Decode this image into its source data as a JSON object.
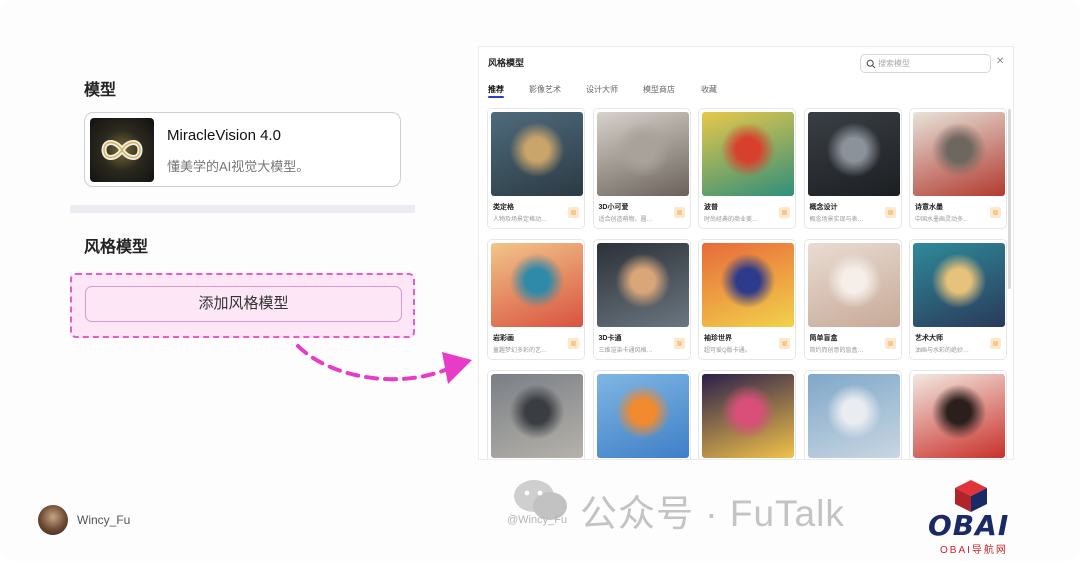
{
  "left": {
    "model_section_title": "模型",
    "model_name": "MiracleVision 4.0",
    "model_desc": "懂美学的AI视觉大模型。",
    "style_section_title": "风格模型",
    "add_style_button": "添加风格模型"
  },
  "dialog": {
    "title": "风格模型",
    "search_placeholder": "搜索模型",
    "close_symbol": "✕",
    "tabs": [
      "推荐",
      "影像艺术",
      "设计大师",
      "模型商店",
      "收藏"
    ],
    "active_tab": "推荐",
    "cards": [
      {
        "name": "类定格",
        "desc": "人物及场景定格动…",
        "colors": [
          "#4e6b7c",
          "#c9a46b",
          "#2c3a44"
        ]
      },
      {
        "name": "3D小可爱",
        "desc": "适合创造萌物。圆…",
        "colors": [
          "#d8d2cc",
          "#a9a29a",
          "#6a625a"
        ]
      },
      {
        "name": "波普",
        "desc": "时尚经典的商业美…",
        "colors": [
          "#e8c84a",
          "#d8402e",
          "#2f8f7a"
        ]
      },
      {
        "name": "概念设计",
        "desc": "概念场景实现与表…",
        "colors": [
          "#3a3f45",
          "#8b929a",
          "#1c1f22"
        ]
      },
      {
        "name": "诗意水墨",
        "desc": "中国水墨画灵动多…",
        "colors": [
          "#e7e3da",
          "#6d6760",
          "#b23a2f"
        ]
      },
      {
        "name": "岩彩画",
        "desc": "童趣梦幻多彩的艺…",
        "colors": [
          "#f2c58a",
          "#2e8aa8",
          "#d9533f"
        ]
      },
      {
        "name": "3D卡通",
        "desc": "三维渲染卡通风格…",
        "colors": [
          "#2c3138",
          "#d9a67a",
          "#6b7680"
        ]
      },
      {
        "name": "袖珍世界",
        "desc": "超可爱Q版卡通。",
        "colors": [
          "#e86a3a",
          "#2e3a8a",
          "#f2d24a"
        ]
      },
      {
        "name": "简单盲盒",
        "desc": "简约而创意的盲盒…",
        "colors": [
          "#e9dcd2",
          "#f6efe9",
          "#c7a998"
        ]
      },
      {
        "name": "艺术大师",
        "desc": "油画与水彩的绝妙…",
        "colors": [
          "#2e8a9a",
          "#e7c27a",
          "#2a3a5a"
        ]
      },
      {
        "name": "",
        "desc": "",
        "colors": [
          "#7a7f86",
          "#3a3d42",
          "#b6b2aa"
        ]
      },
      {
        "name": "",
        "desc": "",
        "colors": [
          "#7fb6e3",
          "#f28a2e",
          "#3f7fc7"
        ]
      },
      {
        "name": "",
        "desc": "",
        "colors": [
          "#2a1f4a",
          "#d94f7a",
          "#f2c24a"
        ]
      },
      {
        "name": "",
        "desc": "",
        "colors": [
          "#7fa8c9",
          "#e9ecf0",
          "#c9d6e2"
        ]
      },
      {
        "name": "",
        "desc": "",
        "colors": [
          "#f2e9e0",
          "#2a1f1c",
          "#c9302a"
        ]
      }
    ]
  },
  "footer": {
    "author": "Wincy_Fu",
    "watermark_handle": "@Wincy_Fu",
    "watermark_text": "公众号 · FuTalk",
    "logo_text": "OBAI",
    "logo_sub": "OBAI导航网"
  },
  "colors": {
    "accent_blue": "#2b3bd6",
    "highlight_pink": "#e85cc7",
    "highlight_bg": "#fde6f6"
  }
}
